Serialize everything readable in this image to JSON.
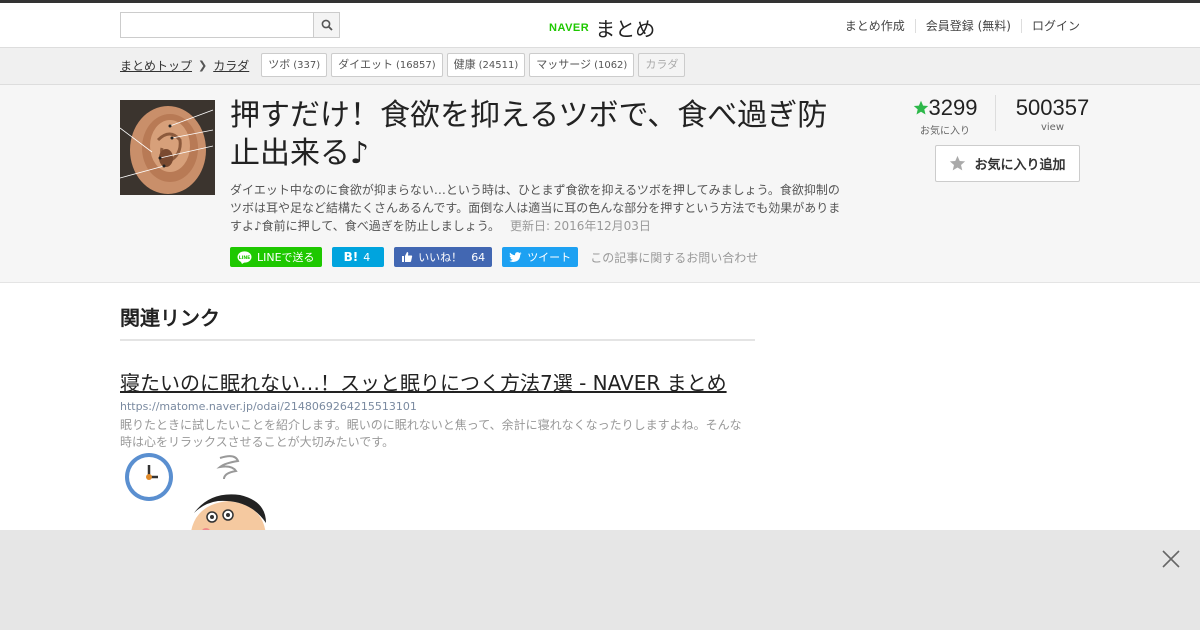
{
  "header": {
    "search": {
      "value": "",
      "placeholder": ""
    },
    "logo": {
      "brand": "NAVER",
      "name": "まとめ"
    },
    "nav": [
      "まとめ作成",
      "会員登録 (無料)",
      "ログイン"
    ]
  },
  "breadcrumb": {
    "items": [
      "まとめトップ",
      "カラダ"
    ],
    "tags": [
      {
        "label": "ツボ",
        "count": "(337)"
      },
      {
        "label": "ダイエット",
        "count": "(16857)"
      },
      {
        "label": "健康",
        "count": "(24511)"
      },
      {
        "label": "マッサージ",
        "count": "(1062)"
      },
      {
        "label": "カラダ",
        "count": ""
      }
    ]
  },
  "article": {
    "title": "押すだけ！食欲を抑えるツボで、食べ過ぎ防止出来る♪",
    "description": "ダイエット中なのに食欲が抑まらない…という時は、ひとまず食欲を抑えるツボを押してみましょう。食欲抑制のツボは耳や足など結構たくさんあるんです。面倒な人は適当に耳の色んな部分を押すという方法でも効果がありますよ♪食前に押して、食べ過ぎを防止しましょう。",
    "updated": "更新日: 2016年12月03日",
    "favorites": "3299",
    "favorites_label": "お気に入り",
    "views": "500357",
    "views_label": "view",
    "fav_button": "お気に入り追加"
  },
  "share": {
    "line": "LINEで送る",
    "hatena_icon": "B!",
    "hatena_count": "4",
    "fb": "いいね！",
    "fb_count": "64",
    "tweet": "ツイート",
    "contact": "この記事に関するお問い合わせ"
  },
  "related": {
    "heading": "関連リンク",
    "link": {
      "title": "寝たいのに眠れない…！スッと眠りにつく方法7選 - NAVER まとめ",
      "url": "https://matome.naver.jp/odai/2148069264215513101",
      "desc": "眠りたときに試したいことを紹介します。眠いのに眠れないと焦って、余計に寝れなくなったりしますよね。そんな時は心をリラックスさせることが大切みたいです。"
    }
  },
  "colors": {
    "naver_green": "#1ec800",
    "hatena": "#00a4de",
    "facebook": "#4267b2",
    "twitter": "#1da1f2"
  }
}
